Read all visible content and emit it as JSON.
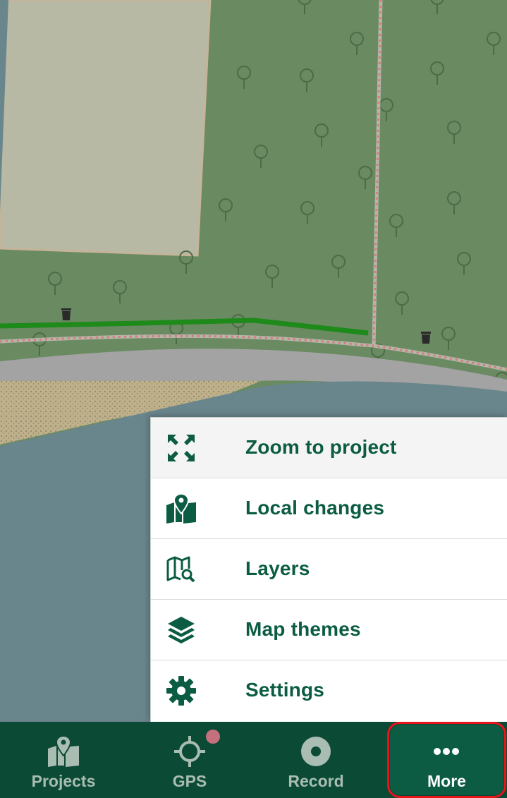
{
  "map": {
    "colors": {
      "forest": "#6a8a62",
      "building": "#b8b9a4",
      "water": "#6a868d",
      "sand": "#bdb08a",
      "road": "#a3a3a3",
      "track": "#1e8a1a",
      "path": "#d77c7c"
    }
  },
  "menu": {
    "items": [
      {
        "label": "Zoom to project",
        "icon": "zoom-to-project-icon"
      },
      {
        "label": "Local changes",
        "icon": "local-changes-icon"
      },
      {
        "label": "Layers",
        "icon": "layers-icon"
      },
      {
        "label": "Map themes",
        "icon": "map-themes-icon"
      },
      {
        "label": "Settings",
        "icon": "settings-icon"
      }
    ],
    "accent": "#0b5c43"
  },
  "bottom_nav": {
    "items": [
      {
        "label": "Projects",
        "icon": "projects-icon"
      },
      {
        "label": "GPS",
        "icon": "gps-icon"
      },
      {
        "label": "Record",
        "icon": "record-icon"
      },
      {
        "label": "More",
        "icon": "more-icon"
      }
    ],
    "background": "#0b4a35",
    "active_color": "#0b5c43",
    "highlight_color": "#e8141c",
    "gps_status_color": "#c4707d"
  }
}
